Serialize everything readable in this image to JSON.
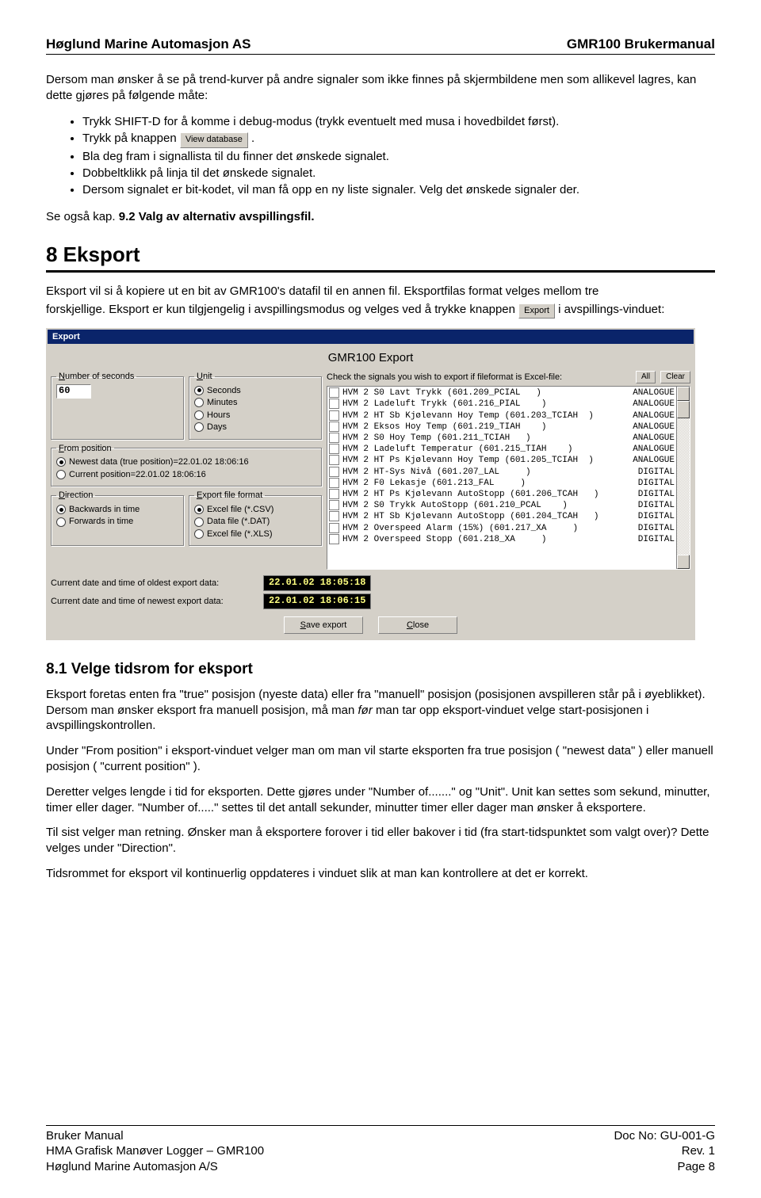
{
  "header": {
    "left": "Høglund Marine Automasjon AS",
    "right": "GMR100 Brukermanual"
  },
  "intro_p": "Dersom man ønsker å se på trend-kurver på andre signaler som ikke finnes på skjermbildene men som allikevel lagres, kan dette gjøres på følgende måte:",
  "bullets": {
    "b1": "Trykk SHIFT-D for å komme i debug-modus (trykk eventuelt med musa i hovedbildet først).",
    "b2a": "Trykk på knappen ",
    "b2_btn": "View database",
    "b2b": ".",
    "b3": "Bla deg fram i signallista til du finner det ønskede signalet.",
    "b4": "Dobbeltklikk på linja til det ønskede signalet.",
    "b5": "Dersom signalet er bit-kodet, vil man få opp en ny liste signaler. Velg det ønskede signaler der."
  },
  "see_also": "Se også kap. ",
  "see_also_bold": "9.2 Valg av alternativ avspillingsfil.",
  "h1_sec8": "8   Eksport",
  "p8a": "Eksport vil si å kopiere ut en bit av GMR100's datafil til en annen fil. Eksportfilas format velges mellom tre",
  "p8b_a": "forskjellige. Eksport er kun tilgjengelig i avspillingsmodus og velges ved å trykke knappen ",
  "p8b_btn": "Export",
  "p8b_b": " i avspillings-vinduet:",
  "dlg": {
    "title": "Export",
    "caption": "GMR100 Export",
    "num_seconds_lbl": "Number of seconds",
    "num_seconds_val": "60",
    "unit_lbl": "Unit",
    "unit_seconds": "Seconds",
    "unit_minutes": "Minutes",
    "unit_hours": "Hours",
    "unit_days": "Days",
    "from_lbl": "From position",
    "from_newest": "Newest data (true position)=22.01.02 18:06:16",
    "from_current": "Current position=22.01.02 18:06:16",
    "dir_lbl": "Direction",
    "dir_back": "Backwards in time",
    "dir_fwd": "Forwards in time",
    "fmt_lbl": "Export file format",
    "fmt_csv": "Excel file (*.CSV)",
    "fmt_dat": "Data file (*.DAT)",
    "fmt_xls": "Excel file (*.XLS)",
    "sig_lbl": "Check the signals you wish to export if fileformat is Excel-file:",
    "btn_all": "All",
    "btn_clear": "Clear",
    "signals": [
      {
        "name": "HVM 2 S0 Lavt Trykk (601.209_PCIAL   )",
        "type": "ANALOGUE"
      },
      {
        "name": "HVM 2 Ladeluft Trykk (601.216_PIAL    )",
        "type": "ANALOGUE"
      },
      {
        "name": "HVM 2 HT Sb Kjølevann Hoy Temp (601.203_TCIAH  )",
        "type": "ANALOGUE"
      },
      {
        "name": "HVM 2 Eksos Hoy Temp (601.219_TIAH    )",
        "type": "ANALOGUE"
      },
      {
        "name": "HVM 2 S0 Hoy Temp (601.211_TCIAH   )",
        "type": "ANALOGUE"
      },
      {
        "name": "HVM 2 Ladeluft Temperatur (601.215_TIAH    )",
        "type": "ANALOGUE"
      },
      {
        "name": "HVM 2 HT Ps Kjølevann Hoy Temp (601.205_TCIAH  )",
        "type": "ANALOGUE"
      },
      {
        "name": "HVM 2 HT-Sys Nivå (601.207_LAL     )",
        "type": "DIGITAL"
      },
      {
        "name": "HVM 2 F0 Lekasje (601.213_FAL     )",
        "type": "DIGITAL"
      },
      {
        "name": "HVM 2 HT Ps Kjølevann AutoStopp (601.206_TCAH   )",
        "type": "DIGITAL"
      },
      {
        "name": "HVM 2 S0 Trykk AutoStopp (601.210_PCAL    )",
        "type": "DIGITAL"
      },
      {
        "name": "HVM 2 HT Sb Kjølevann AutoStopp (601.204_TCAH   )",
        "type": "DIGITAL"
      },
      {
        "name": "HVM 2 Overspeed Alarm (15%) (601.217_XA     )",
        "type": "DIGITAL"
      },
      {
        "name": "HVM 2 Overspeed Stopp (601.218_XA     )",
        "type": "DIGITAL"
      }
    ],
    "oldest_lbl": "Current date and time of oldest export data:",
    "oldest_val": "22.01.02 18:05:18",
    "newest_lbl": "Current date and time of newest export data:",
    "newest_val": "22.01.02 18:06:15",
    "btn_save": "Save export",
    "btn_close": "Close"
  },
  "h2_81": "8.1  Velge tidsrom for eksport",
  "p81a": "Eksport foretas enten fra \"true\" posisjon (nyeste data) eller fra \"manuell\" posisjon (posisjonen avspilleren står på i øyeblikket). Dersom man ønsker eksport fra manuell posisjon, må man ",
  "p81a_ital": "før",
  "p81a2": " man tar opp eksport-vinduet velge start-posisjonen i avspillingskontrollen.",
  "p81b": "Under \"From position\" i eksport-vinduet velger man om man vil starte eksporten fra true posisjon ( \"newest data\" ) eller manuell posisjon ( \"current position\" ).",
  "p81c": "Deretter velges lengde i tid for eksporten. Dette gjøres under \"Number of.......\" og \"Unit\". Unit kan settes som sekund, minutter, timer eller dager. \"Number of.....\" settes til det antall sekunder, minutter timer eller dager man ønsker å eksportere.",
  "p81d": "Til sist velger man retning. Ønsker man å eksportere forover i tid eller bakover i tid (fra start-tidspunktet som valgt over)? Dette velges under \"Direction\".",
  "p81e": "Tidsrommet for eksport vil kontinuerlig oppdateres i vinduet slik at man kan kontrollere at det er korrekt.",
  "footer": {
    "l1": "Bruker Manual",
    "l2": "HMA Grafisk Manøver Logger – GMR100",
    "l3": "Høglund Marine Automasjon A/S",
    "r1": "Doc No: GU-001-G",
    "r2": "Rev. 1",
    "r3": "Page 8"
  }
}
